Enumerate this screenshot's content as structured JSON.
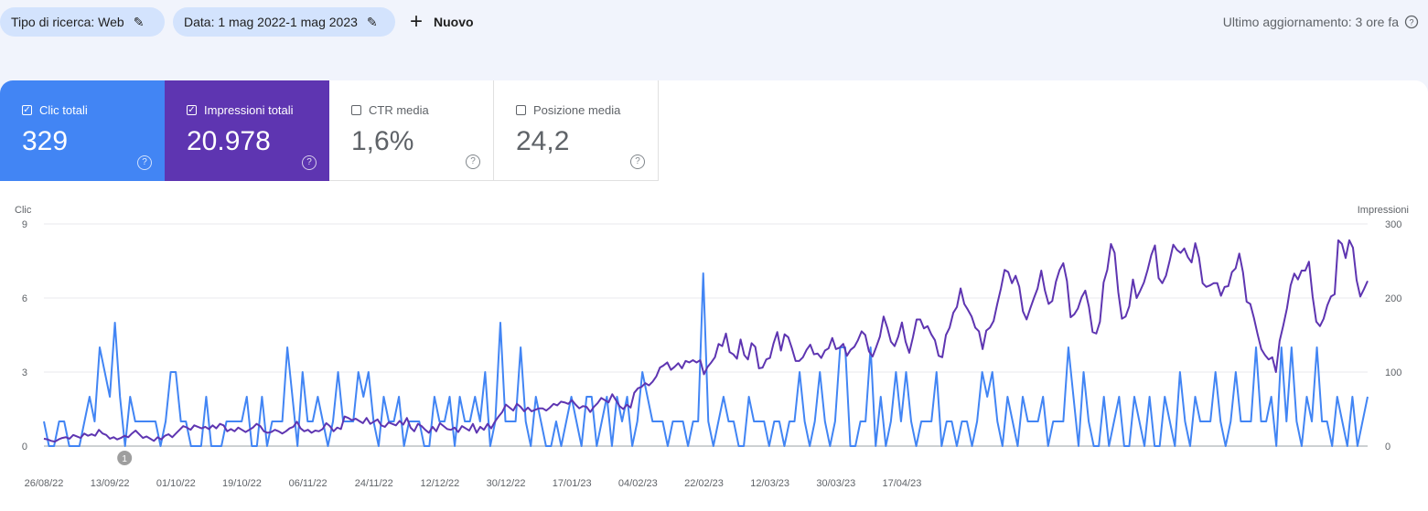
{
  "filters": {
    "search_type": "Tipo di ricerca: Web",
    "date": "Data: 1 mag 2022-1 mag 2023",
    "new_label": "Nuovo"
  },
  "last_update": "Ultimo aggiornamento: 3 ore fa",
  "metrics": {
    "clicks": {
      "label": "Clic totali",
      "value": "329",
      "checked": true
    },
    "impressions": {
      "label": "Impressioni totali",
      "value": "20.978",
      "checked": true
    },
    "ctr": {
      "label": "CTR media",
      "value": "1,6%",
      "checked": false
    },
    "position": {
      "label": "Posizione media",
      "value": "24,2",
      "checked": false
    }
  },
  "colors": {
    "clicks": "#4285f4",
    "impressions": "#5e35b1",
    "background": "#f1f4fc"
  },
  "icons": [
    "pencil-icon",
    "plus-icon",
    "help-icon",
    "checkbox-icon"
  ],
  "chart_data": {
    "type": "line",
    "y_left": {
      "label": "Clic",
      "min": 0,
      "max": 9,
      "ticks": [
        0,
        3,
        6,
        9
      ]
    },
    "y_right": {
      "label": "Impressioni",
      "min": 0,
      "max": 300,
      "ticks": [
        0,
        100,
        200,
        300
      ]
    },
    "x_tick_labels": [
      "26/08/22",
      "13/09/22",
      "01/10/22",
      "19/10/22",
      "06/11/22",
      "24/11/22",
      "12/12/22",
      "30/12/22",
      "17/01/23",
      "04/02/23",
      "22/02/23",
      "12/03/23",
      "30/03/23",
      "17/04/23"
    ],
    "x_start": "26/08/22",
    "grid": true,
    "annotation": {
      "text": "1",
      "date": "17/09/22"
    },
    "series": [
      {
        "name": "Clic",
        "axis": "left",
        "values": [
          1,
          0,
          0,
          1,
          1,
          0,
          0,
          0,
          1,
          2,
          1,
          4,
          3,
          2,
          5,
          2,
          0,
          2,
          1,
          1,
          1,
          1,
          1,
          0,
          1,
          3,
          3,
          1,
          1,
          0,
          0,
          0,
          2,
          0,
          0,
          0,
          1,
          1,
          1,
          1,
          2,
          0,
          0,
          2,
          0,
          1,
          1,
          1,
          4,
          2,
          0,
          3,
          1,
          1,
          2,
          1,
          0,
          1,
          3,
          1,
          1,
          1,
          3,
          2,
          3,
          1,
          0,
          2,
          1,
          1,
          2,
          0,
          1,
          1,
          1,
          0,
          0,
          2,
          1,
          1,
          2,
          0,
          2,
          1,
          1,
          2,
          1,
          3,
          0,
          1,
          5,
          1,
          1,
          1,
          4,
          1,
          0,
          2,
          1,
          0,
          0,
          1,
          0,
          1,
          2,
          1,
          0,
          2,
          2,
          0,
          1,
          2,
          0,
          2,
          1,
          2,
          0,
          1,
          3,
          2,
          1,
          1,
          1,
          0,
          1,
          1,
          1,
          0,
          1,
          1,
          7,
          1,
          0,
          1,
          2,
          1,
          1,
          0,
          0,
          2,
          1,
          1,
          1,
          0,
          1,
          1,
          0,
          1,
          1,
          3,
          1,
          0,
          1,
          3,
          1,
          0,
          1,
          4,
          4,
          0,
          0,
          1,
          1,
          4,
          0,
          2,
          0,
          1,
          3,
          1,
          3,
          1,
          0,
          1,
          1,
          1,
          3,
          0,
          1,
          1,
          0,
          1,
          1,
          0,
          1,
          3,
          2,
          3,
          1,
          0,
          2,
          1,
          0,
          2,
          1,
          1,
          1,
          2,
          0,
          1,
          1,
          1,
          4,
          2,
          0,
          3,
          1,
          0,
          0,
          2,
          0,
          1,
          2,
          0,
          0,
          2,
          1,
          0,
          2,
          0,
          0,
          2,
          1,
          0,
          3,
          1,
          0,
          2,
          1,
          1,
          1,
          3,
          1,
          0,
          1,
          3,
          1,
          1,
          1,
          4,
          1,
          1,
          2,
          0,
          4,
          1,
          4,
          1,
          0,
          2,
          1,
          4,
          1,
          1,
          0,
          2,
          1,
          0,
          2,
          0,
          1,
          2
        ]
      },
      {
        "name": "Impressioni",
        "axis": "right",
        "values": [
          10,
          9,
          7,
          6,
          9,
          11,
          12,
          10,
          15,
          13,
          11,
          17,
          14,
          16,
          14,
          22,
          17,
          15,
          10,
          12,
          9,
          11,
          14,
          12,
          17,
          21,
          16,
          11,
          13,
          10,
          7,
          12,
          9,
          14,
          16,
          12,
          17,
          22,
          27,
          25,
          22,
          28,
          26,
          24,
          26,
          23,
          28,
          24,
          30,
          28,
          20,
          23,
          20,
          25,
          22,
          19,
          22,
          25,
          30,
          27,
          20,
          18,
          19,
          22,
          20,
          17,
          20,
          24,
          26,
          33,
          24,
          20,
          22,
          18,
          21,
          20,
          23,
          31,
          27,
          20,
          25,
          23,
          40,
          38,
          35,
          37,
          34,
          31,
          38,
          30,
          33,
          36,
          28,
          26,
          32,
          30,
          28,
          34,
          29,
          38,
          25,
          20,
          30,
          27,
          22,
          18,
          26,
          20,
          31,
          27,
          23,
          22,
          25,
          19,
          27,
          24,
          21,
          30,
          18,
          26,
          22,
          30,
          24,
          33,
          40,
          46,
          56,
          52,
          48,
          57,
          53,
          47,
          52,
          47,
          49,
          51,
          51,
          48,
          52,
          57,
          55,
          60,
          59,
          57,
          62,
          56,
          51,
          54,
          53,
          46,
          53,
          58,
          65,
          62,
          59,
          70,
          62,
          54,
          50,
          56,
          52,
          72,
          78,
          80,
          85,
          82,
          87,
          94,
          106,
          109,
          113,
          103,
          107,
          112,
          105,
          115,
          113,
          116,
          113,
          116,
          97,
          107,
          113,
          120,
          138,
          135,
          152,
          127,
          124,
          118,
          144,
          123,
          117,
          139,
          134,
          105,
          106,
          117,
          119,
          139,
          154,
          129,
          151,
          147,
          132,
          115,
          115,
          120,
          130,
          137,
          124,
          125,
          119,
          129,
          132,
          146,
          131,
          133,
          138,
          122,
          130,
          134,
          143,
          155,
          150,
          128,
          121,
          134,
          148,
          175,
          160,
          141,
          135,
          148,
          167,
          141,
          126,
          147,
          171,
          171,
          159,
          162,
          151,
          143,
          122,
          120,
          150,
          160,
          180,
          188,
          213,
          192,
          184,
          175,
          160,
          155,
          131,
          156,
          160,
          169,
          192,
          213,
          238,
          235,
          220,
          230,
          215,
          182,
          171,
          186,
          200,
          213,
          237,
          210,
          192,
          196,
          222,
          238,
          247,
          223,
          174,
          178,
          186,
          201,
          210,
          188,
          154,
          152,
          168,
          221,
          238,
          273,
          261,
          208,
          172,
          175,
          189,
          225,
          200,
          210,
          221,
          238,
          258,
          271,
          227,
          220,
          230,
          250,
          272,
          265,
          261,
          267,
          255,
          248,
          274,
          255,
          220,
          215,
          217,
          220,
          220,
          203,
          215,
          216,
          235,
          240,
          260,
          235,
          195,
          192,
          173,
          151,
          131,
          123,
          117,
          120,
          100,
          142,
          163,
          186,
          217,
          233,
          225,
          237,
          237,
          249,
          202,
          168,
          162,
          172,
          190,
          202,
          205,
          278,
          273,
          254,
          278,
          268,
          224,
          202,
          212,
          223
        ]
      }
    ]
  }
}
